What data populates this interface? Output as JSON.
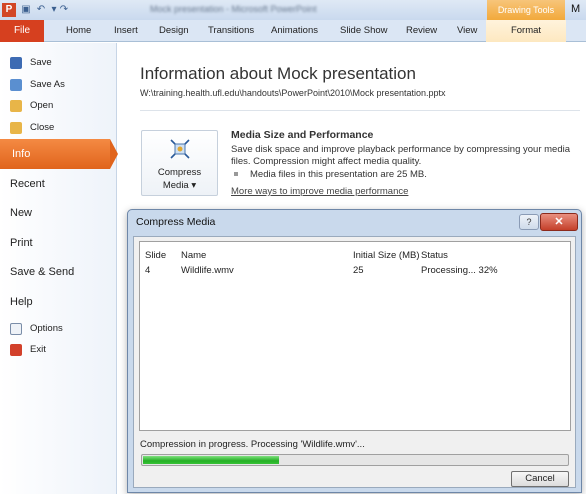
{
  "titlebar": {
    "app_icon": "P",
    "title": "Mock presentation - Microsoft PowerPoint",
    "contextual_tab": "Drawing Tools",
    "right_text": "M"
  },
  "ribbon": {
    "file": "File",
    "tabs": [
      "Home",
      "Insert",
      "Design",
      "Transitions",
      "Animations",
      "Slide Show",
      "Review",
      "View"
    ],
    "format": "Format"
  },
  "backstage": {
    "save": "Save",
    "save_as": "Save As",
    "open": "Open",
    "close": "Close",
    "info": "Info",
    "recent": "Recent",
    "new": "New",
    "print": "Print",
    "save_send": "Save & Send",
    "help": "Help",
    "options": "Options",
    "exit": "Exit"
  },
  "info_page": {
    "title": "Information about Mock presentation",
    "path": "W:\\training.health.ufl.edu\\handouts\\PowerPoint\\2010\\Mock presentation.pptx",
    "compress_button_line1": "Compress",
    "compress_button_line2": "Media ▾",
    "section_heading": "Media Size and Performance",
    "section_description": "Save disk space and improve playback performance by compressing your media files. Compression might affect media quality.",
    "bullet": "Media files in this presentation are 25 MB.",
    "link": "More ways to improve media performance"
  },
  "dialog": {
    "title": "Compress Media",
    "help": "?",
    "close": "✕",
    "columns": [
      "Slide",
      "Name",
      "Initial Size (MB)",
      "Status"
    ],
    "rows": [
      {
        "slide": "4",
        "name": "Wildlife.wmv",
        "size": "25",
        "status": "Processing... 32%"
      }
    ],
    "status_line": "Compression in progress. Processing 'Wildlife.wmv'...",
    "progress_fraction": 0.32,
    "cancel": "Cancel"
  },
  "colors": {
    "file_tab": "#d6401f",
    "info_active": "#e0641c",
    "progress": "#25b025"
  }
}
